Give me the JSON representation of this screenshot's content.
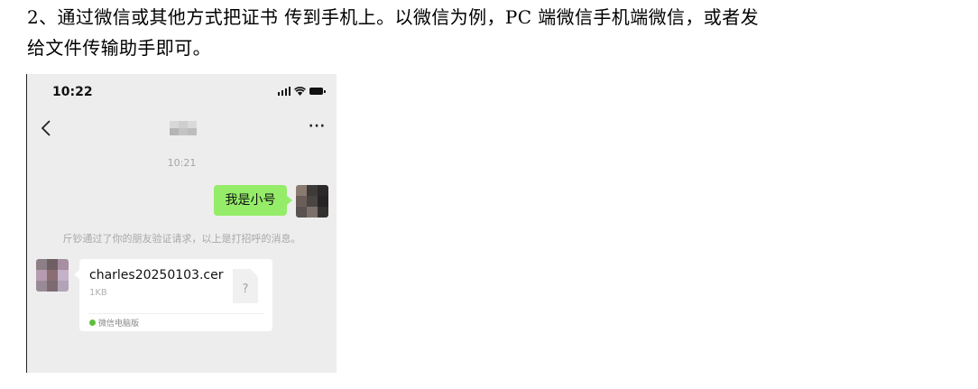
{
  "paragraph": {
    "line1": "2、通过微信或其他方式把证书  传到手机上。以微信为例，PC 端微信手机端微信，或者发",
    "line2": "给文件传输助手即可。"
  },
  "phone": {
    "status_time": "10:22",
    "more_label": "···",
    "timestamp": "10:21",
    "my_message": "我是小号",
    "system_message": "斤钞通过了你的朋友验证请求，以上是打招呼的消息。",
    "file": {
      "name": "charles20250103.cer",
      "size": "1KB",
      "icon_glyph": "?",
      "source": "微信电脑版"
    },
    "icons": [
      "back-arrow-icon",
      "more-icon",
      "signal-icon",
      "wifi-icon",
      "battery-icon",
      "file-icon",
      "wechat-icon"
    ],
    "colors": {
      "chat_bg": "#ededed",
      "bubble_green": "#95ec69",
      "card_bg": "#ffffff"
    }
  }
}
